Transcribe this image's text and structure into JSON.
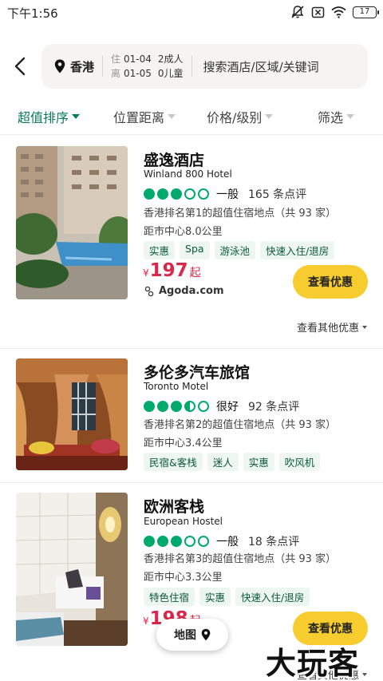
{
  "status_bar": {
    "time": "下午1:56",
    "battery": "17"
  },
  "header": {
    "city": "香港",
    "checkin_label": "住",
    "checkin_date": "01-04",
    "adults": "2成人",
    "checkout_label": "离",
    "checkout_date": "01-05",
    "children": "0儿童",
    "search_placeholder": "搜索酒店/区域/关键词"
  },
  "filters": [
    {
      "label": "超值排序",
      "active": true
    },
    {
      "label": "位置距离",
      "active": false
    },
    {
      "label": "价格/级别",
      "active": false
    },
    {
      "label": "筛选",
      "active": false
    }
  ],
  "hotels": [
    {
      "name": "盛逸酒店",
      "english_name": "Winland 800 Hotel",
      "rating": 3,
      "rating_label": "一般",
      "reviews": "165 条点评",
      "rank": "香港排名第1的超值住宿地点（共 93 家）",
      "distance": "距市中心8.0公里",
      "tags": [
        "实惠",
        "Spa",
        "游泳池",
        "快速入住/退房"
      ],
      "currency": "¥",
      "price": "197",
      "price_suffix": "起",
      "provider": "Agoda.com",
      "deal_button": "查看优惠",
      "more_deals": "查看其他优惠"
    },
    {
      "name": "多伦多汽车旅馆",
      "english_name": "Toronto Motel",
      "rating": 3.5,
      "rating_label": "很好",
      "reviews": "92 条点评",
      "rank": "香港排名第2的超值住宿地点（共 93 家）",
      "distance": "距市中心3.4公里",
      "tags": [
        "民宿&客栈",
        "迷人",
        "实惠",
        "吹风机"
      ]
    },
    {
      "name": "欧洲客栈",
      "english_name": "European Hostel",
      "rating": 3,
      "rating_label": "一般",
      "reviews": "18 条点评",
      "rank": "香港排名第3的超值住宿地点（共 93 家）",
      "distance": "距市中心3.3公里",
      "tags": [
        "特色住宿",
        "实惠",
        "快速入住/退房"
      ],
      "currency": "¥",
      "price": "198",
      "price_suffix": "起",
      "deal_button": "查看优惠",
      "more_deals": "查看其他优惠"
    }
  ],
  "map_button": "地图",
  "watermark": "大玩客"
}
